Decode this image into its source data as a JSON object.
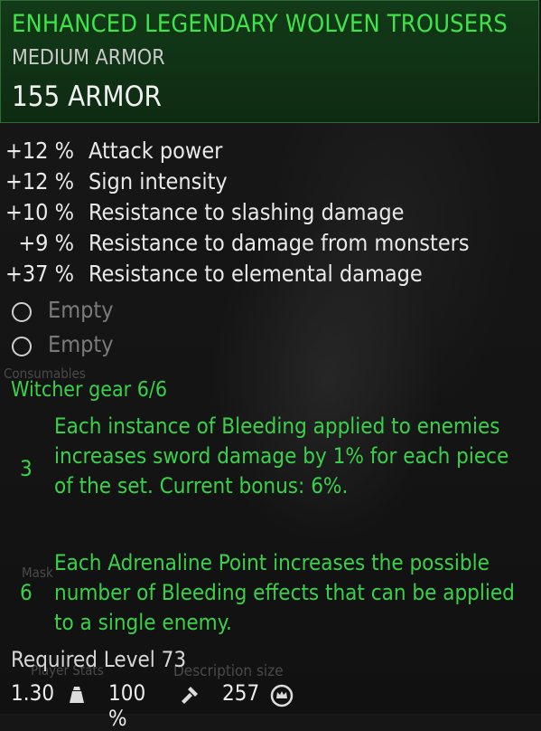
{
  "item": {
    "title": "ENHANCED LEGENDARY WOLVEN TROUSERS",
    "type": "MEDIUM ARMOR",
    "armor": "155 ARMOR"
  },
  "stats": [
    {
      "value": "+12 %",
      "name": "Attack power"
    },
    {
      "value": "+12 %",
      "name": "Sign intensity"
    },
    {
      "value": "+10 %",
      "name": "Resistance to slashing damage"
    },
    {
      "value": "+9 %",
      "name": "Resistance to damage from monsters"
    },
    {
      "value": "+37 %",
      "name": "Resistance to elemental damage"
    }
  ],
  "slots": [
    {
      "label": "Empty"
    },
    {
      "label": "Empty"
    }
  ],
  "set": {
    "title": "Witcher gear 6/6",
    "bonuses": [
      {
        "pieces": "3",
        "text": "Each instance of Bleeding applied to enemies increases sword damage by 1% for each piece of the set. Current bonus: 6%."
      },
      {
        "pieces": "6",
        "text": "Each Adrenaline Point increases the possible number of Bleeding effects that can be applied to a single enemy."
      }
    ]
  },
  "required_level": "Required Level 73",
  "footer": {
    "weight": "1.30",
    "durability": "100 %",
    "price": "257"
  },
  "background_text": {
    "consumables": "Consumables",
    "masks": "Mask",
    "player_stats": "Player Stats",
    "description_size": "Description size"
  },
  "colors": {
    "title_green": "#3ee54a",
    "set_green": "#3ad14a",
    "header_bg": "#123a18"
  },
  "icons": {
    "slot": "empty-slot-circle-icon",
    "weight": "weight-icon",
    "durability": "hammer-icon",
    "price": "crowns-icon"
  }
}
